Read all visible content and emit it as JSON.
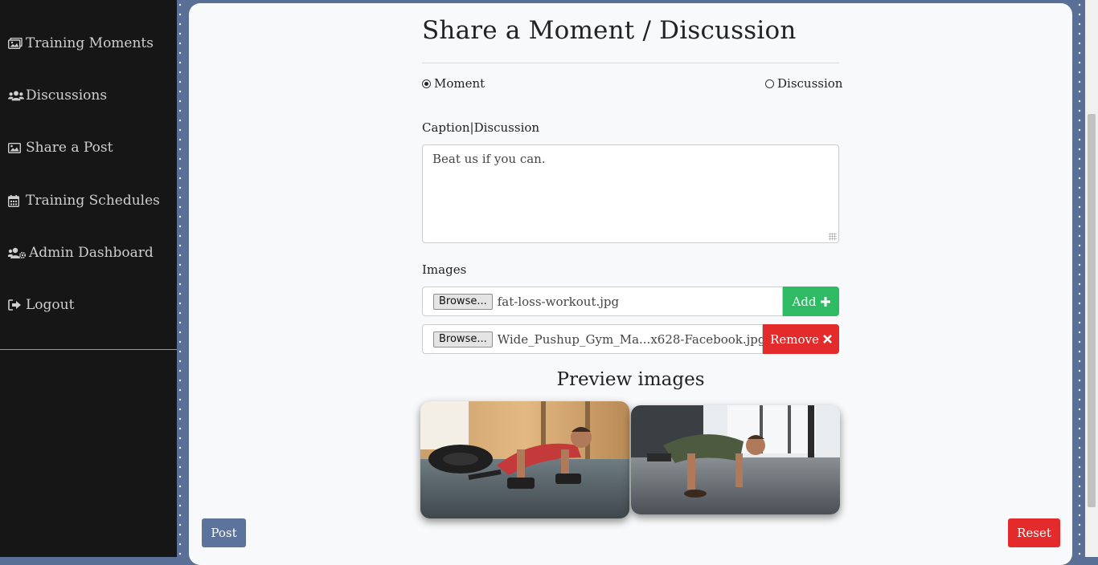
{
  "sidebar": {
    "items": [
      {
        "label": "Training Moments",
        "icon": "images-icon"
      },
      {
        "label": "Discussions",
        "icon": "users-icon"
      },
      {
        "label": "Share a Post",
        "icon": "image-icon"
      },
      {
        "label": "Training Schedules",
        "icon": "calendar-icon"
      },
      {
        "label": "Admin Dashboard",
        "icon": "users-cog-icon"
      },
      {
        "label": "Logout",
        "icon": "sign-out-icon"
      }
    ]
  },
  "form": {
    "title": "Share a Moment / Discussion",
    "post_type": {
      "options": [
        "Moment",
        "Discussion"
      ],
      "selected": "Moment"
    },
    "caption_label": "Caption|Discussion",
    "caption_value": "Beat us if you can.",
    "images_label": "Images",
    "files": [
      {
        "browse_label": "Browse...",
        "file_name": "fat-loss-workout.jpg",
        "action_label": "Add"
      },
      {
        "browse_label": "Browse...",
        "file_name": "Wide_Pushup_Gym_Ma...x628-Facebook.jpg",
        "action_label": "Remove"
      }
    ],
    "preview_title": "Preview images",
    "post_label": "Post",
    "reset_label": "Reset"
  },
  "colors": {
    "sidebar_bg": "#161616",
    "page_bg": "#5a6f96",
    "card_bg": "#f8f9fa",
    "success": "#2fba64",
    "danger": "#e32b2b",
    "primary": "#5c739b"
  }
}
